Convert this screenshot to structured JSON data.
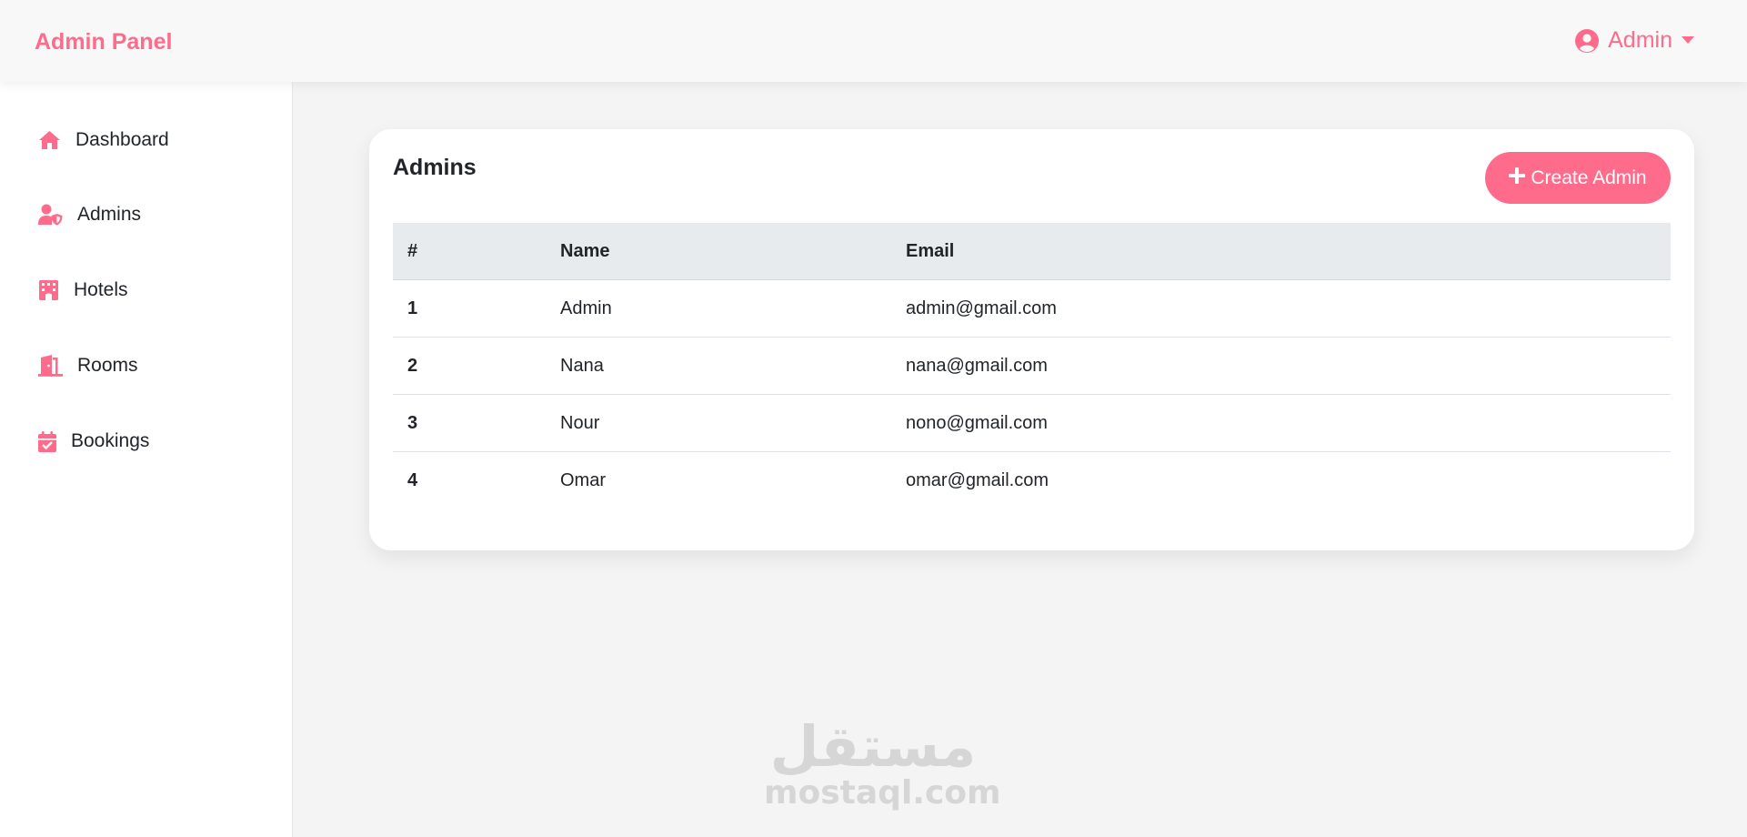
{
  "topbar": {
    "brand": "Admin Panel",
    "user_label": "Admin",
    "user_icon": "user-circle-icon",
    "dropdown_icon": "caret-down-icon"
  },
  "sidebar": {
    "items": [
      {
        "label": "Dashboard",
        "icon": "home-icon"
      },
      {
        "label": "Admins",
        "icon": "user-shield-icon"
      },
      {
        "label": "Hotels",
        "icon": "hotel-icon"
      },
      {
        "label": "Rooms",
        "icon": "door-open-icon"
      },
      {
        "label": "Bookings",
        "icon": "calendar-check-icon"
      }
    ]
  },
  "main": {
    "title": "Admins",
    "create_label": "Create Admin",
    "table": {
      "headers": [
        "#",
        "Name",
        "Email"
      ],
      "rows": [
        [
          "1",
          "Admin",
          "admin@gmail.com"
        ],
        [
          "2",
          "Nana",
          "nana@gmail.com"
        ],
        [
          "3",
          "Nour",
          "nono@gmail.com"
        ],
        [
          "4",
          "Omar",
          "omar@gmail.com"
        ]
      ]
    }
  },
  "watermark": {
    "arabic": "مستقل",
    "latin": "mostaql.com"
  },
  "colors": {
    "accent": "#fe6b8b",
    "page_bg": "#f4f4f4",
    "table_header_bg": "#e8ebee"
  }
}
